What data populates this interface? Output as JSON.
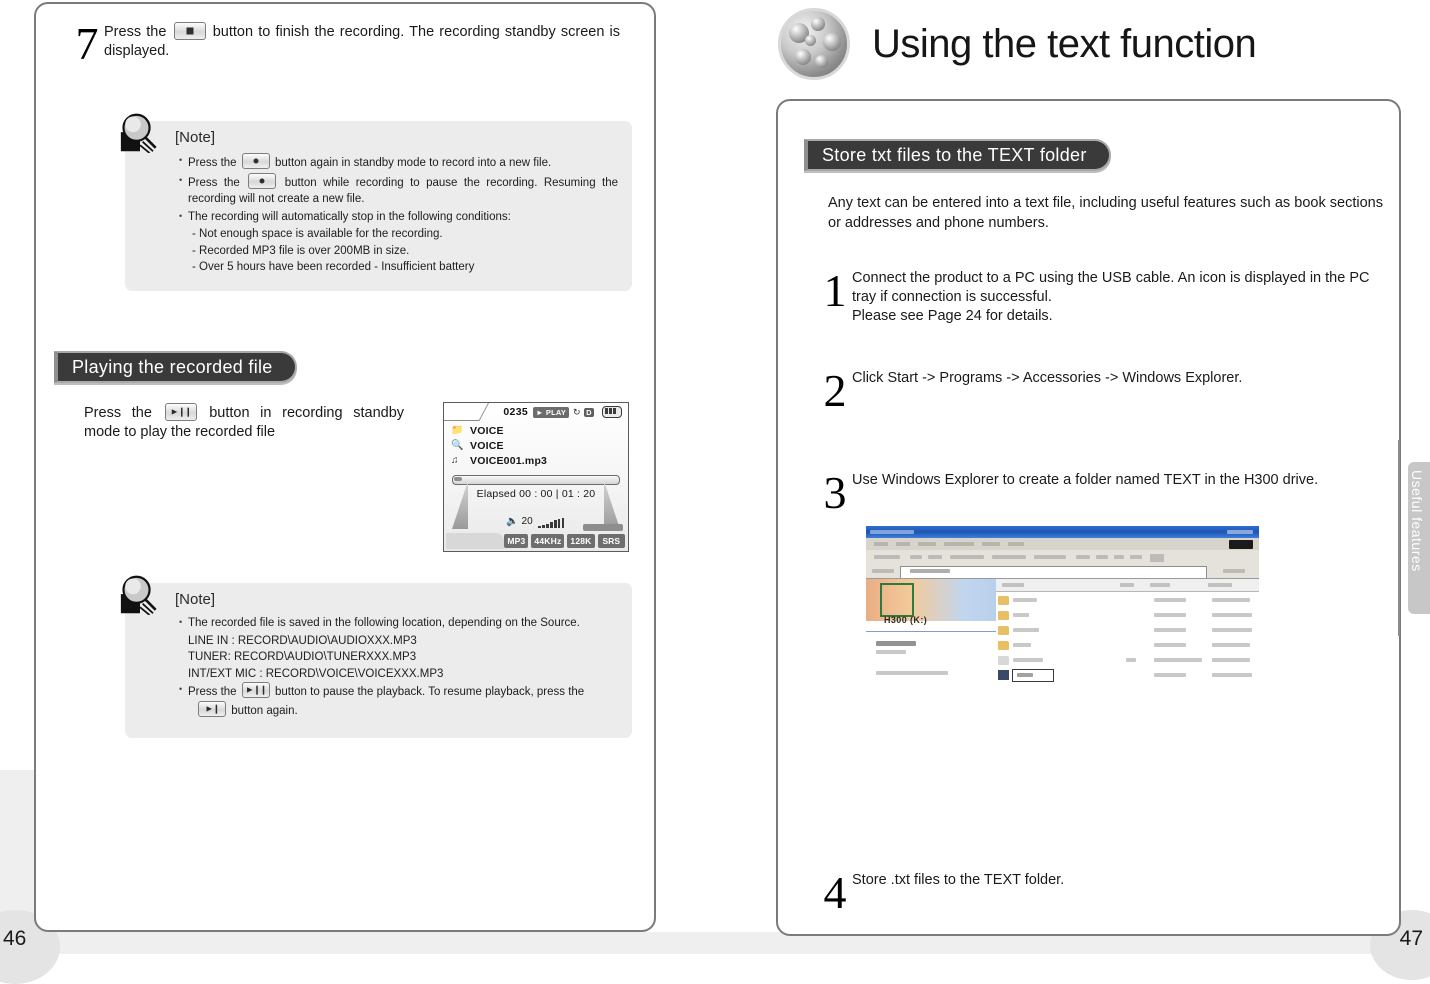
{
  "spread": {
    "left_page_number": "46",
    "right_page_number": "47",
    "side_tab_label": "Useful features"
  },
  "left_page": {
    "step7": {
      "number": "7",
      "text_before_key": "Press the",
      "key_icon": "stop-button-icon",
      "text_after_key": "button to finish the recording. The recording standby screen is displayed."
    },
    "note1": {
      "title": "[Note]",
      "icon": "magnifier-note-icon",
      "items": [
        {
          "pre": "Press the",
          "key": "record-button-icon",
          "post": "button again in standby mode to record into a new file."
        },
        {
          "pre": "Press the",
          "key": "record-button-icon",
          "post": "button while recording to pause the recording. Resuming the recording will not create a new file."
        },
        {
          "pre": "",
          "key": "",
          "post": "The recording will automatically stop in the following conditions:"
        }
      ],
      "conditions": [
        "- Not enough space is available for the recording.",
        "- Recorded MP3 file is over 200MB in size.",
        "- Over 5 hours have been recorded   - Insufficient battery"
      ]
    },
    "section_header": "Playing the recorded file",
    "play_instruction": {
      "pre": "Press the",
      "key": "play-pause-button-icon",
      "post": "button in recording standby mode to play the recorded file"
    },
    "lcd": {
      "track_number": "0235",
      "play_badge": "PLAY",
      "repeat_icon": "repeat-icon",
      "mode_badge": "D",
      "battery_icon": "battery-icon",
      "rows": [
        {
          "icon": "folder-icon",
          "text": "VOICE"
        },
        {
          "icon": "search-icon",
          "text": "VOICE"
        },
        {
          "icon": "music-file-icon",
          "text": "VOICE001.mp3"
        }
      ],
      "elapsed_label": "Elapsed",
      "elapsed_time": "00 : 00",
      "total_time": "01 : 20",
      "volume_icon": "speaker-icon",
      "volume_value": "20",
      "tags": [
        "MP3",
        "44KHz",
        "128K"
      ],
      "srs_label": "SRS"
    },
    "note2": {
      "title": "[Note]",
      "icon": "magnifier-note-icon",
      "line1": "The recorded file is saved in the following location, depending on the Source.",
      "paths": [
        "LINE IN : RECORD\\AUDIO\\AUDIOXXX.MP3",
        "TUNER: RECORD\\AUDIO\\TUNERXXX.MP3",
        "INT/EXT MIC : RECORD\\VOICE\\VOICEXXX.MP3"
      ],
      "line2_pre": "Press the",
      "line2_key": "play-pause-button-icon",
      "line2_mid": "button to pause the playback. To resume playback, press the",
      "line2_key2": "play-button-icon",
      "line2_post": "button again."
    }
  },
  "right_page": {
    "title": "Using the text function",
    "title_icon": "chrome-spheres-icon",
    "section_header": "Store txt files to the TEXT folder",
    "intro": "Any text can be entered into a text file, including useful features such as book sections or addresses and phone numbers.",
    "steps": [
      {
        "number": "1",
        "text": "Connect the product to a PC using the USB cable. An icon is displayed in the PC tray if connection is successful.\nPlease see Page 24 for details."
      },
      {
        "number": "2",
        "text": "Click Start -> Programs -> Accessories -> Windows Explorer."
      },
      {
        "number": "3",
        "text": "Use Windows Explorer to create a folder named TEXT in the H300 drive."
      },
      {
        "number": "4",
        "text": "Store .txt files to the TEXT folder."
      }
    ],
    "explorer_screenshot": {
      "alt": "windows-explorer-screenshot",
      "drive_label": "H300 (K:)"
    }
  },
  "colors": {
    "pill_bg": "#3a3a3a",
    "note_bg": "#ececec",
    "frame": "#7b7b7b",
    "page_bg": "#ffffff"
  }
}
